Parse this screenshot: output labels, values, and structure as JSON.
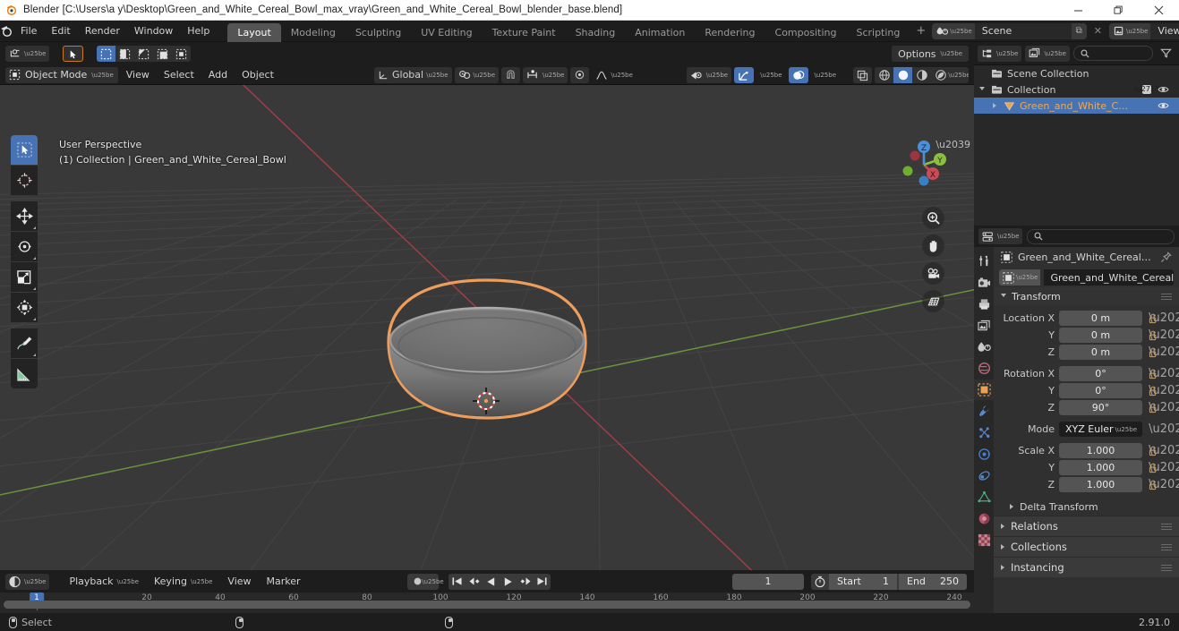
{
  "window": {
    "title": "Blender [C:\\Users\\a y\\Desktop\\Green_and_White_Cereal_Bowl_max_vray\\Green_and_White_Cereal_Bowl_blender_base.blend]",
    "minimize": "–",
    "maximize": "❐",
    "close": "✕"
  },
  "menus": [
    "File",
    "Edit",
    "Render",
    "Window",
    "Help"
  ],
  "workspaces": [
    {
      "label": "Layout",
      "active": true
    },
    {
      "label": "Modeling",
      "active": false
    },
    {
      "label": "Sculpting",
      "active": false
    },
    {
      "label": "UV Editing",
      "active": false
    },
    {
      "label": "Texture Paint",
      "active": false
    },
    {
      "label": "Shading",
      "active": false
    },
    {
      "label": "Animation",
      "active": false
    },
    {
      "label": "Rendering",
      "active": false
    },
    {
      "label": "Compositing",
      "active": false
    },
    {
      "label": "Scripting",
      "active": false
    }
  ],
  "workspace_add": "+",
  "topbar": {
    "scene_name": "Scene",
    "view_layer_name": "View Layer",
    "new_copy": "⧉",
    "unlink": "✕"
  },
  "viewport": {
    "mode": "Object Mode",
    "menus": [
      "View",
      "Select",
      "Add",
      "Object"
    ],
    "transform_orientation": "Global",
    "options_label": "Options",
    "overlay_text_line1": "User Perspective",
    "overlay_text_line2": "(1) Collection | Green_and_White_Cereal_Bowl",
    "gizmo_axes": [
      "X",
      "Y",
      "Z"
    ],
    "selected_outline_color": "#ed9e5c",
    "background_color": "#393939",
    "grid_color": "#4b4b4b",
    "x_axis_color": "#a33b4a",
    "y_axis_color": "#6a933b"
  },
  "tools": [
    {
      "name": "tweak-tool",
      "active": true
    },
    {
      "name": "cursor-tool",
      "active": false
    },
    {
      "name": "move-tool",
      "active": false
    },
    {
      "name": "rotate-tool",
      "active": false
    },
    {
      "name": "scale-tool",
      "active": false
    },
    {
      "name": "transform-tool",
      "active": false
    },
    {
      "name": "annotate-tool",
      "active": false
    },
    {
      "name": "measure-tool",
      "active": false
    }
  ],
  "outliner": {
    "search_placeholder": "",
    "rows": [
      {
        "label": "Scene Collection",
        "level": 0,
        "selected": false,
        "disclosure": "none",
        "icon": "collection-icon",
        "checkbox": false,
        "eye": false
      },
      {
        "label": "Collection",
        "level": 1,
        "selected": false,
        "disclosure": "down",
        "icon": "collection-icon",
        "checkbox": true,
        "eye": true
      },
      {
        "label": "Green_and_White_C…",
        "level": 2,
        "selected": true,
        "disclosure": "right",
        "icon": "mesh-object-icon",
        "checkbox": false,
        "eye": true
      }
    ]
  },
  "properties": {
    "search_placeholder": "",
    "breadcrumb_object": "Green_and_White_Cereal…",
    "object_name": "Green_and_White_Cereal_B…",
    "tabs": [
      {
        "name": "tool-tab",
        "active": false
      },
      {
        "name": "render-tab",
        "active": false
      },
      {
        "name": "output-tab",
        "active": false
      },
      {
        "name": "view-layer-tab",
        "active": false
      },
      {
        "name": "scene-tab",
        "active": false
      },
      {
        "name": "world-tab",
        "active": false
      },
      {
        "name": "object-tab",
        "active": true
      },
      {
        "name": "modifier-tab",
        "active": false
      },
      {
        "name": "particles-tab",
        "active": false
      },
      {
        "name": "physics-tab",
        "active": false
      },
      {
        "name": "constraints-tab",
        "active": false
      },
      {
        "name": "data-tab",
        "active": false
      },
      {
        "name": "material-tab",
        "active": false
      },
      {
        "name": "texture-tab",
        "active": false
      }
    ],
    "transform": {
      "title": "Transform",
      "location": {
        "label_x": "Location X",
        "label_y": "Y",
        "label_z": "Z",
        "x": "0 m",
        "y": "0 m",
        "z": "0 m"
      },
      "rotation": {
        "label_x": "Rotation X",
        "label_y": "Y",
        "label_z": "Z",
        "x": "0°",
        "y": "0°",
        "z": "90°"
      },
      "mode_label": "Mode",
      "mode_value": "XYZ Euler",
      "scale": {
        "label_x": "Scale X",
        "label_y": "Y",
        "label_z": "Z",
        "x": "1.000",
        "y": "1.000",
        "z": "1.000"
      },
      "delta_transform": "Delta Transform"
    },
    "closed_panels": [
      "Relations",
      "Collections",
      "Instancing"
    ]
  },
  "timeline": {
    "menus": [
      "Playback",
      "Keying",
      "View",
      "Marker"
    ],
    "current_frame": "1",
    "start_label": "Start",
    "start_value": "1",
    "end_label": "End",
    "end_value": "250",
    "ticks": [
      "20",
      "40",
      "60",
      "80",
      "100",
      "120",
      "140",
      "160",
      "180",
      "200",
      "220",
      "240"
    ],
    "playhead_label": "1"
  },
  "statusbar": {
    "select_label": "Select",
    "version": "2.91.0"
  }
}
